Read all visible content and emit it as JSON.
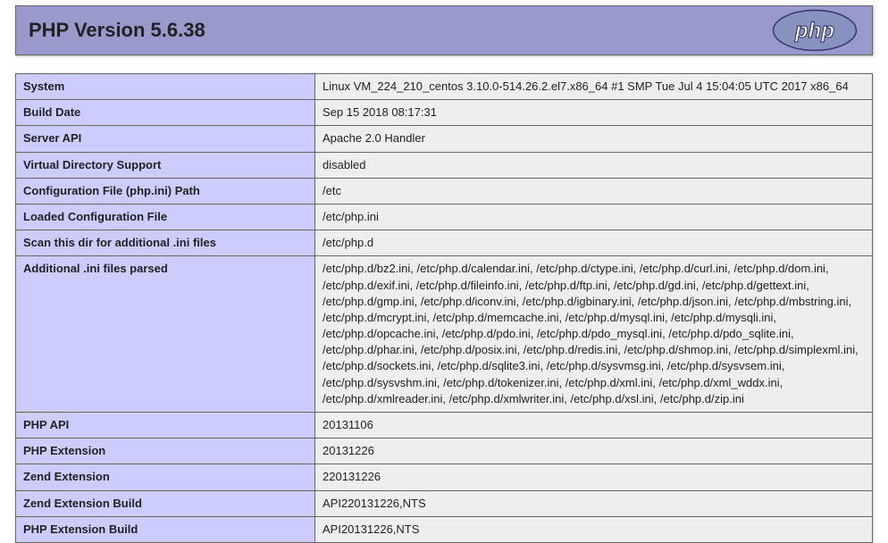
{
  "header": {
    "title": "PHP Version 5.6.38"
  },
  "rows": [
    {
      "label": "System",
      "value": "Linux VM_224_210_centos 3.10.0-514.26.2.el7.x86_64 #1 SMP Tue Jul 4 15:04:05 UTC 2017 x86_64"
    },
    {
      "label": "Build Date",
      "value": "Sep 15 2018 08:17:31"
    },
    {
      "label": "Server API",
      "value": "Apache 2.0 Handler"
    },
    {
      "label": "Virtual Directory Support",
      "value": "disabled"
    },
    {
      "label": "Configuration File (php.ini) Path",
      "value": "/etc"
    },
    {
      "label": "Loaded Configuration File",
      "value": "/etc/php.ini"
    },
    {
      "label": "Scan this dir for additional .ini files",
      "value": "/etc/php.d"
    },
    {
      "label": "Additional .ini files parsed",
      "value": "/etc/php.d/bz2.ini, /etc/php.d/calendar.ini, /etc/php.d/ctype.ini, /etc/php.d/curl.ini, /etc/php.d/dom.ini, /etc/php.d/exif.ini, /etc/php.d/fileinfo.ini, /etc/php.d/ftp.ini, /etc/php.d/gd.ini, /etc/php.d/gettext.ini, /etc/php.d/gmp.ini, /etc/php.d/iconv.ini, /etc/php.d/igbinary.ini, /etc/php.d/json.ini, /etc/php.d/mbstring.ini, /etc/php.d/mcrypt.ini, /etc/php.d/memcache.ini, /etc/php.d/mysql.ini, /etc/php.d/mysqli.ini, /etc/php.d/opcache.ini, /etc/php.d/pdo.ini, /etc/php.d/pdo_mysql.ini, /etc/php.d/pdo_sqlite.ini, /etc/php.d/phar.ini, /etc/php.d/posix.ini, /etc/php.d/redis.ini, /etc/php.d/shmop.ini, /etc/php.d/simplexml.ini, /etc/php.d/sockets.ini, /etc/php.d/sqlite3.ini, /etc/php.d/sysvmsg.ini, /etc/php.d/sysvsem.ini, /etc/php.d/sysvshm.ini, /etc/php.d/tokenizer.ini, /etc/php.d/xml.ini, /etc/php.d/xml_wddx.ini, /etc/php.d/xmlreader.ini, /etc/php.d/xmlwriter.ini, /etc/php.d/xsl.ini, /etc/php.d/zip.ini"
    },
    {
      "label": "PHP API",
      "value": "20131106"
    },
    {
      "label": "PHP Extension",
      "value": "20131226"
    },
    {
      "label": "Zend Extension",
      "value": "220131226"
    },
    {
      "label": "Zend Extension Build",
      "value": "API220131226,NTS"
    },
    {
      "label": "PHP Extension Build",
      "value": "API20131226,NTS"
    }
  ]
}
